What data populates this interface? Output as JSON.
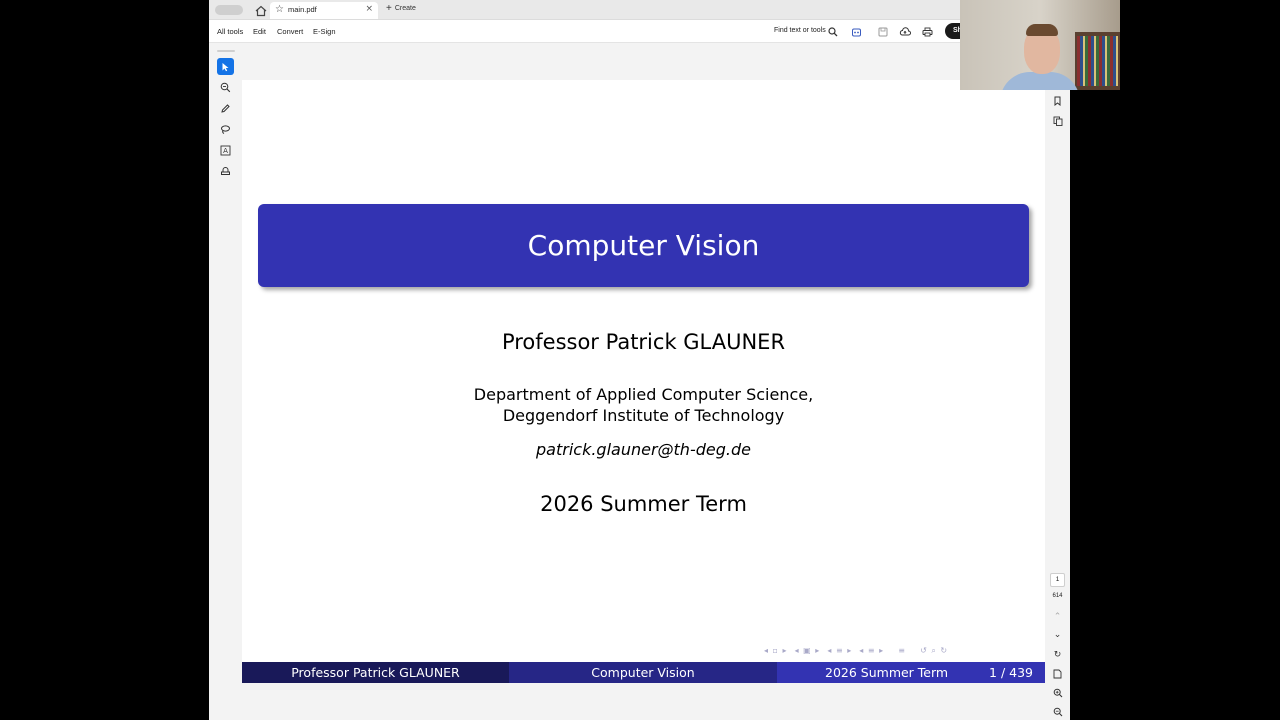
{
  "browser": {
    "tab_title": "main.pdf",
    "tab_close": "×",
    "new_tab_label": "Create"
  },
  "toolbar": {
    "menu": [
      "All tools",
      "Edit",
      "Convert",
      "E-Sign"
    ],
    "find_label": "Find text or tools",
    "share_label": "Sh"
  },
  "left_tools": [
    "select-tool",
    "zoom-tool",
    "draw-tool",
    "lasso-tool",
    "text-tool",
    "stamp-tool"
  ],
  "page_nav": {
    "current_page": "1",
    "total_pages": "614"
  },
  "slide": {
    "title": "Computer Vision",
    "author": "Professor Patrick GLAUNER",
    "department_line1": "Department of Applied Computer Science,",
    "department_line2": "Deggendorf Institute of Technology",
    "email": "patrick.glauner@th-deg.de",
    "term": "2026 Summer Term",
    "footline": {
      "author": "Professor Patrick GLAUNER",
      "title": "Computer Vision",
      "term": "2026 Summer Term",
      "page": "1 / 439"
    },
    "colors": {
      "title_box": "#3333b2",
      "footline_left": "#191959",
      "footline_middle": "#262686",
      "footline_right": "#3333b2"
    }
  },
  "accent_color": "#1473e6"
}
